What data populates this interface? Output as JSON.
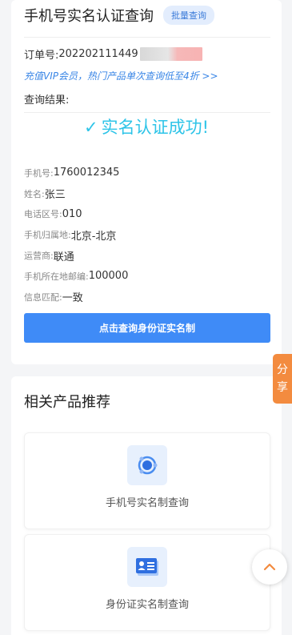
{
  "header": {
    "title": "手机号实名认证查询",
    "batch_label": "批量查询"
  },
  "order": {
    "label": "订单号:",
    "value": "202202111449"
  },
  "vip_promo": "充值VIP会员，热门产品单次查询低至4折 >>",
  "result_label": "查询结果:",
  "success_text": "实名认证成功!",
  "success_icon": "checkmark",
  "info": [
    {
      "key": "手机号:",
      "value": "1760012345"
    },
    {
      "key": "姓名:",
      "value": "张三"
    },
    {
      "key": "电话区号:",
      "value": "010"
    },
    {
      "key": "手机归属地:",
      "value": "北京-北京"
    },
    {
      "key": "运营商:",
      "value": "联通"
    },
    {
      "key": "手机所在地邮编:",
      "value": "100000"
    },
    {
      "key": "信息匹配:",
      "value": "一致"
    }
  ],
  "query_button": "点击查询身份证实名制",
  "recommend": {
    "title": "相关产品推荐",
    "products": [
      {
        "name": "手机号实名制查询",
        "icon": "target-icon"
      },
      {
        "name": "身份证实名制查询",
        "icon": "id-card-icon"
      }
    ]
  },
  "share_tab": [
    "分",
    "享"
  ],
  "colors": {
    "accent": "#3f8bf7",
    "success": "#2ec4e8",
    "link": "#3a86e6",
    "share": "#f38b3f"
  }
}
